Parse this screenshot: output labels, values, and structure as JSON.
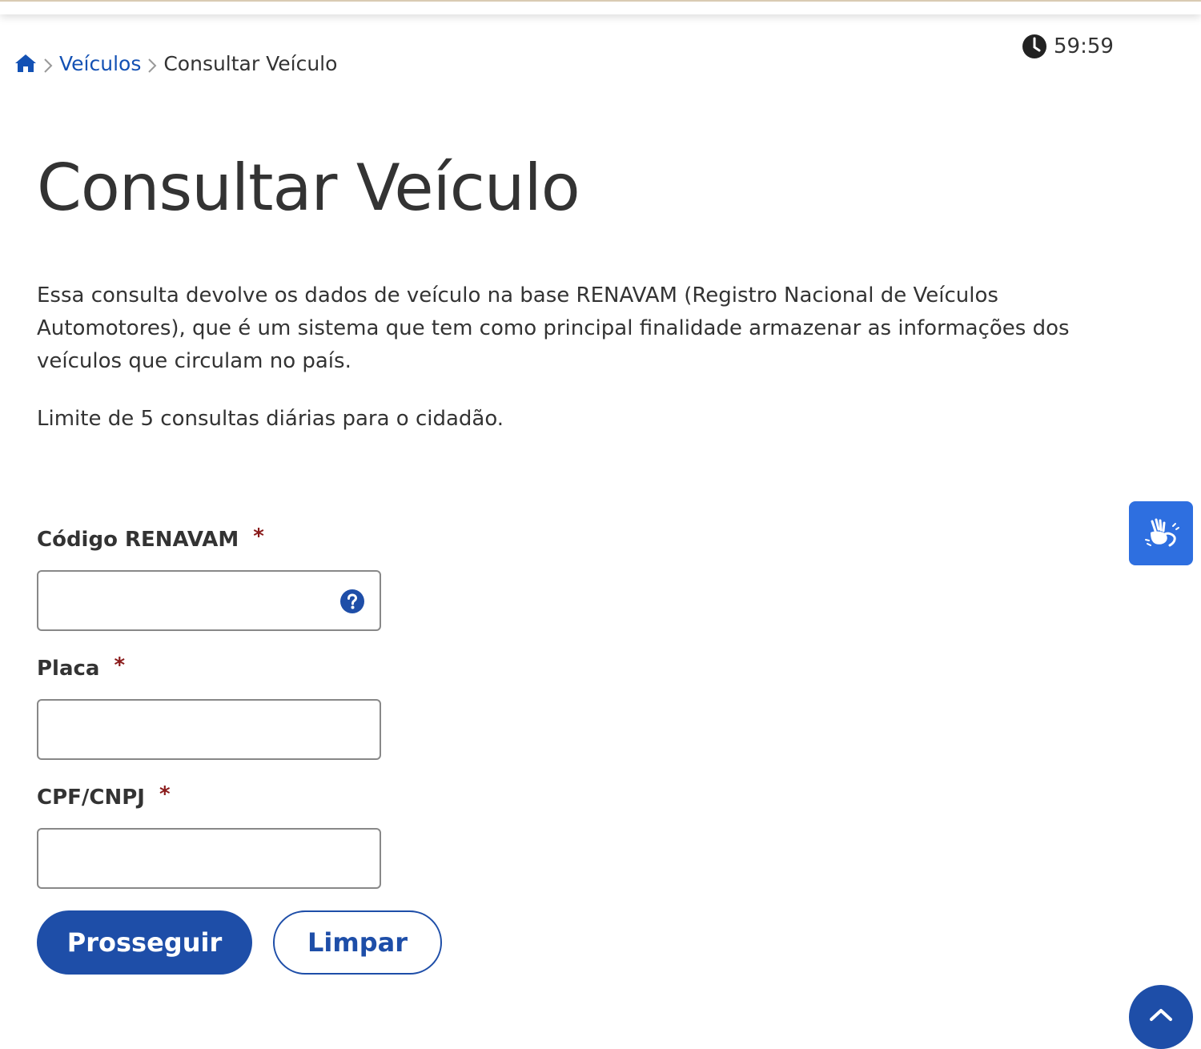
{
  "breadcrumb": {
    "home_icon": "home-icon",
    "separator_icon": "chevron-right-icon",
    "link": "Veículos",
    "current": "Consultar Veículo"
  },
  "timer": {
    "icon": "clock-icon",
    "value": "59:59"
  },
  "page": {
    "title": "Consultar Veículo",
    "description": "Essa consulta devolve os dados de veículo na base RENAVAM (Registro Nacional de Veículos Automotores), que é um sistema que tem como principal finalidade armazenar as informações dos veículos que circulam no país.",
    "limit_note": "Limite de 5 consultas diárias para o cidadão."
  },
  "form": {
    "required_mark": "*",
    "renavam": {
      "label": "Código RENAVAM",
      "value": "",
      "help_icon": "question-circle-icon"
    },
    "placa": {
      "label": "Placa",
      "value": ""
    },
    "cpf_cnpj": {
      "label": "CPF/CNPJ",
      "value": ""
    },
    "submit_label": "Prosseguir",
    "clear_label": "Limpar"
  },
  "floating": {
    "vlibras_icon": "sign-language-hands-icon",
    "back_to_top_icon": "chevron-up-icon"
  },
  "colors": {
    "primary": "#1e4ea8",
    "link": "#1351b4",
    "required": "#8a1a1a",
    "vlibras": "#2e6fe0",
    "text": "#333333"
  }
}
